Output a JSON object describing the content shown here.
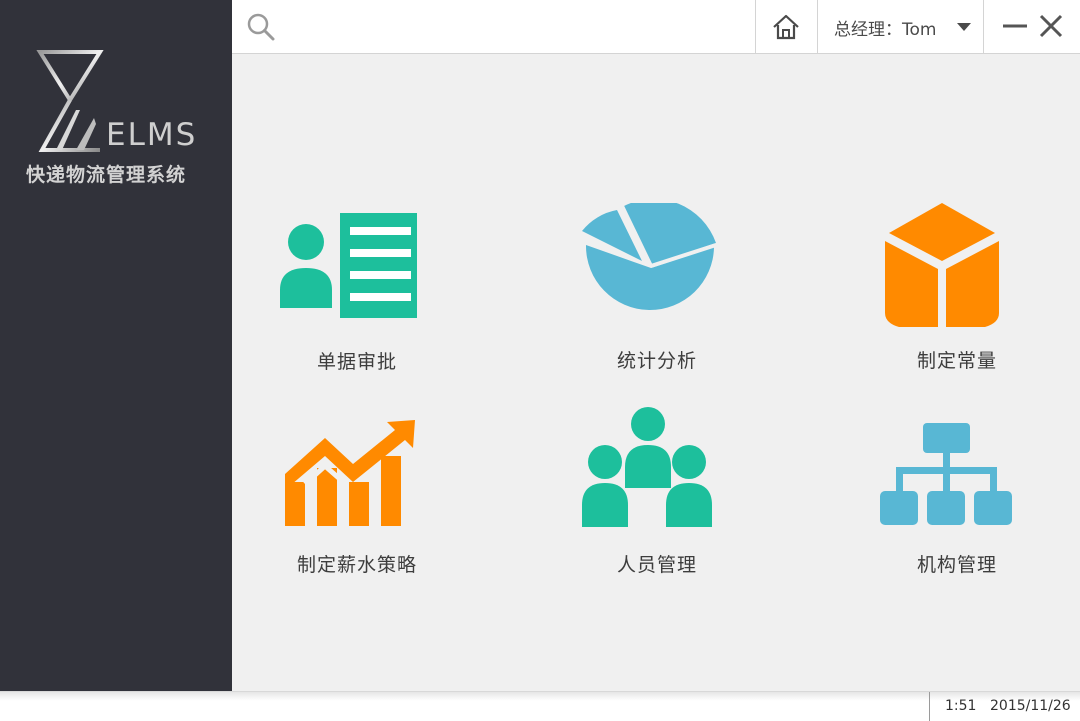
{
  "app": {
    "logo_text": "ELMS",
    "title": "快递物流管理系统"
  },
  "search": {
    "value": "",
    "placeholder": ""
  },
  "header": {
    "user_label": "总经理：Tom"
  },
  "tiles": [
    {
      "label": "单据审批",
      "icon": "document-approval-icon",
      "color": "#1dbf9c"
    },
    {
      "label": "统计分析",
      "icon": "pie-chart-icon",
      "color": "#58b7d4"
    },
    {
      "label": "制定常量",
      "icon": "cube-icon",
      "color": "#ff8a00"
    },
    {
      "label": "制定薪水策略",
      "icon": "growth-chart-icon",
      "color": "#ff8a00"
    },
    {
      "label": "人员管理",
      "icon": "people-group-icon",
      "color": "#1dbf9c"
    },
    {
      "label": "机构管理",
      "icon": "org-chart-icon",
      "color": "#58b7d4"
    }
  ],
  "status": {
    "time": "1:51",
    "date": "2015/11/26"
  },
  "colors": {
    "sidebar": "#31323a",
    "teal": "#1dbf9c",
    "blue": "#58b7d4",
    "orange": "#ff8a00"
  }
}
